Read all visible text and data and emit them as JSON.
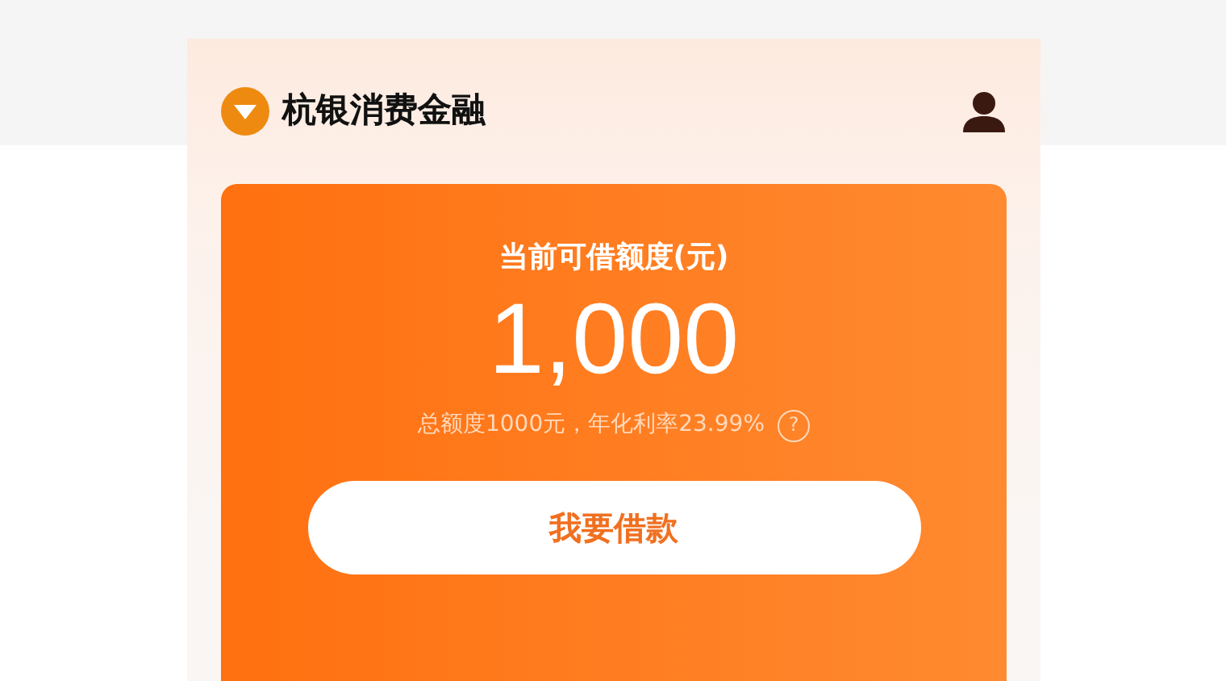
{
  "header": {
    "title": "杭银消费金融"
  },
  "card": {
    "title": "当前可借额度(元)",
    "amount": "1,000",
    "summary": "总额度1000元，年化利率23.99%",
    "help": "?",
    "button": "我要借款"
  }
}
